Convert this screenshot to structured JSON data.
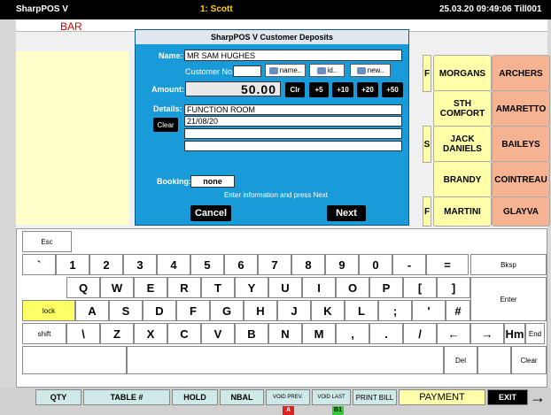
{
  "topbar": {
    "app": "SharpPOS V",
    "user": "1: Scott",
    "datetime": "25.03.20 09:49:06 Till001"
  },
  "subbar": {
    "mode": "BAR"
  },
  "products": {
    "edge_letters": [
      "F",
      "S",
      "F"
    ],
    "yellow": [
      "MORGANS",
      "STH COMFORT",
      "JACK DANIELS",
      "BRANDY",
      "MARTINI"
    ],
    "orange": [
      "ARCHERS",
      "AMARETTO",
      "BAILEYS",
      "COINTREAU",
      "GLAYVA"
    ]
  },
  "dialog": {
    "title": "SharpPOS V Customer Deposits",
    "name_label": "Name:",
    "name_value": "MR SAM HUGHES",
    "customer_no_label": "Customer No:",
    "customer_no_value": "",
    "btn_name": "name..",
    "btn_id": "id..",
    "btn_new": "new..",
    "amount_label": "Amount:",
    "amount_value": "50.00",
    "btn_clr": "Clr",
    "btn_p5": "+5",
    "btn_p10": "+10",
    "btn_p20": "+20",
    "btn_p50": "+50",
    "details_label": "Details:",
    "details_lines": [
      "FUNCTION ROOM",
      "21/08/20",
      "",
      ""
    ],
    "btn_clear": "Clear",
    "booking_label": "Booking:",
    "booking_value": "none",
    "info": "Enter information and press Next",
    "btn_cancel": "Cancel",
    "btn_next": "Next"
  },
  "keyboard": {
    "esc": "Esc",
    "row1": [
      "`",
      "1",
      "2",
      "3",
      "4",
      "5",
      "6",
      "7",
      "8",
      "9",
      "0",
      "-",
      "=",
      "Bksp"
    ],
    "row2": [
      "Q",
      "W",
      "E",
      "R",
      "T",
      "Y",
      "U",
      "I",
      "O",
      "P",
      "[",
      "]",
      "Enter"
    ],
    "row3": [
      "lock",
      "A",
      "S",
      "D",
      "F",
      "G",
      "H",
      "J",
      "K",
      "L",
      ";",
      "'",
      "#"
    ],
    "row4": [
      "shift",
      "\\",
      "Z",
      "X",
      "C",
      "V",
      "B",
      "N",
      "M",
      ",",
      ".",
      "/",
      "←",
      "→",
      "Hm",
      "End"
    ],
    "row5": [
      "Del",
      "Clear"
    ]
  },
  "fbar": {
    "qty": "QTY",
    "table": "TABLE #",
    "hold": "HOLD",
    "nbal": "NBAL",
    "void_prev": "VOID PREV.",
    "void_last": "VOID LAST",
    "print_bill": "PRINT BILL",
    "payment": "PAYMENT",
    "exit": "EXIT",
    "tag_a": "A",
    "tag_b1": "B1"
  },
  "colors": {
    "dialog_bg": "#1a9bd9",
    "key_lock": "#ffff66",
    "product_yellow": "#ffffaa",
    "product_orange": "#f6b391",
    "tag_a": "#e02020",
    "tag_b1": "#33cc33"
  }
}
